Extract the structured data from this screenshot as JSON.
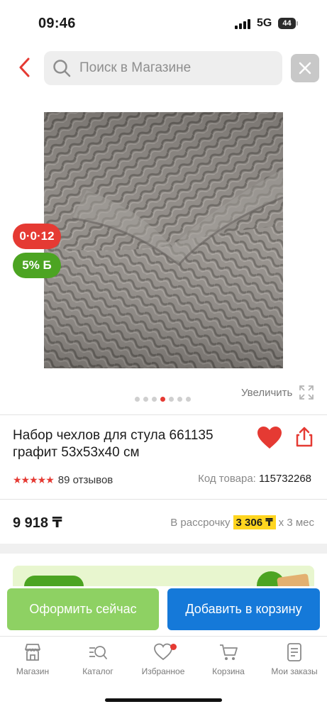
{
  "status_bar": {
    "time": "09:46",
    "network": "5G",
    "battery": "44"
  },
  "header": {
    "search_placeholder": "Поиск в Магазине",
    "back_icon": "chevron-left-icon",
    "close_icon": "close-icon"
  },
  "product": {
    "timer_badge": "0·0·12",
    "discount_badge": "5% Б",
    "gallery": {
      "total": 7,
      "active_index": 3
    },
    "zoom_label": "Увеличить",
    "title": "Набор чехлов для стула 661135 графит 53х53х40 см",
    "rating": 5,
    "reviews": "89 отзывов",
    "code_label": "Код товара:",
    "code_value": "115732268",
    "price": "9 918 ₸",
    "installment_label": "В рассрочку",
    "installment_amount": "3 306 ₸",
    "installment_term": "x 3 мес"
  },
  "actions": {
    "buy_now": "Оформить сейчас",
    "add_to_cart": "Добавить в корзину"
  },
  "bottom_nav": {
    "items": [
      {
        "label": "Магазин",
        "icon": "shop-icon"
      },
      {
        "label": "Каталог",
        "icon": "catalog-search-icon"
      },
      {
        "label": "Избранное",
        "icon": "heart-icon"
      },
      {
        "label": "Корзина",
        "icon": "cart-icon"
      },
      {
        "label": "Мои заказы",
        "icon": "orders-icon"
      }
    ]
  },
  "colors": {
    "accent_red": "#e53a33",
    "green": "#4ca422",
    "light_green_button": "#8ed163",
    "blue_button": "#1579d9",
    "installment_highlight": "#ffd51f"
  }
}
